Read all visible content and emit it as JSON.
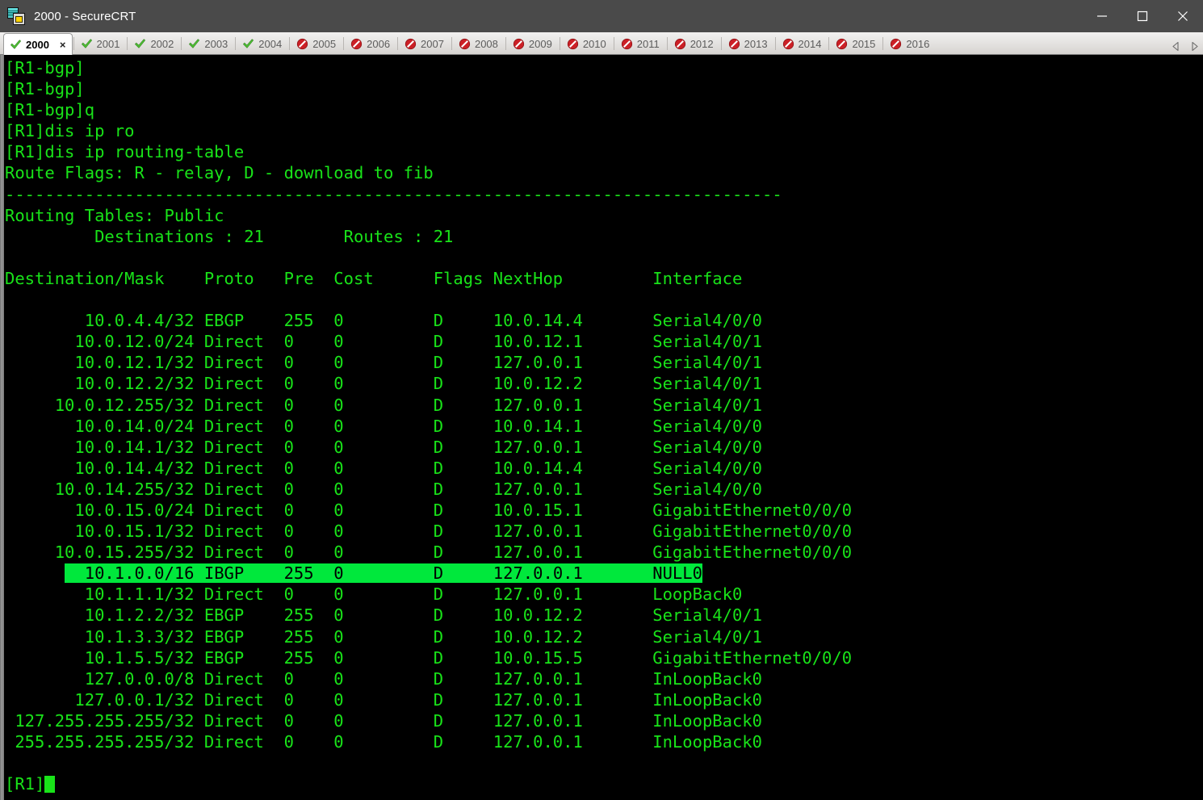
{
  "window": {
    "title": "2000 - SecureCRT",
    "icon": "securecrt-icon",
    "controls": {
      "minimize": "minimize-icon",
      "maximize": "maximize-icon",
      "close": "close-icon"
    }
  },
  "tabs": {
    "items": [
      {
        "label": "2000",
        "status": "connected",
        "active": true,
        "closable": true
      },
      {
        "label": "2001",
        "status": "connected",
        "active": false,
        "closable": false
      },
      {
        "label": "2002",
        "status": "connected",
        "active": false,
        "closable": false
      },
      {
        "label": "2003",
        "status": "connected",
        "active": false,
        "closable": false
      },
      {
        "label": "2004",
        "status": "connected",
        "active": false,
        "closable": false
      },
      {
        "label": "2005",
        "status": "disconnected",
        "active": false,
        "closable": false
      },
      {
        "label": "2006",
        "status": "disconnected",
        "active": false,
        "closable": false
      },
      {
        "label": "2007",
        "status": "disconnected",
        "active": false,
        "closable": false
      },
      {
        "label": "2008",
        "status": "disconnected",
        "active": false,
        "closable": false
      },
      {
        "label": "2009",
        "status": "disconnected",
        "active": false,
        "closable": false
      },
      {
        "label": "2010",
        "status": "disconnected",
        "active": false,
        "closable": false
      },
      {
        "label": "2011",
        "status": "disconnected",
        "active": false,
        "closable": false
      },
      {
        "label": "2012",
        "status": "disconnected",
        "active": false,
        "closable": false
      },
      {
        "label": "2013",
        "status": "disconnected",
        "active": false,
        "closable": false
      },
      {
        "label": "2014",
        "status": "disconnected",
        "active": false,
        "closable": false
      },
      {
        "label": "2015",
        "status": "disconnected",
        "active": false,
        "closable": false
      },
      {
        "label": "2016",
        "status": "disconnected",
        "active": false,
        "closable": false
      }
    ],
    "close_glyph": "×",
    "nav_prev": "scroll-tabs-left-icon",
    "nav_next": "scroll-tabs-right-icon"
  },
  "terminal": {
    "colors": {
      "background": "#000000",
      "foreground": "#19e319",
      "selection_background": "#00e83c",
      "selection_foreground": "#000000"
    },
    "scrollback": [
      "[R1-bgp]",
      "[R1-bgp]",
      "[R1-bgp]q",
      "[R1]dis ip ro",
      "[R1]dis ip routing-table",
      "Route Flags: R - relay, D - download to fib",
      "------------------------------------------------------------------------------",
      "Routing Tables: Public",
      "         Destinations : 21        Routes : 21",
      ""
    ],
    "table_header": "Destination/Mask    Proto   Pre  Cost      Flags NextHop         Interface",
    "blank_after_header": "",
    "rows": [
      {
        "destination": "10.0.4.4/32",
        "proto": "EBGP",
        "pre": "255",
        "cost": "0",
        "flags": "D",
        "nexthop": "10.0.14.4",
        "interface": "Serial4/0/0",
        "selected": false
      },
      {
        "destination": "10.0.12.0/24",
        "proto": "Direct",
        "pre": "0",
        "cost": "0",
        "flags": "D",
        "nexthop": "10.0.12.1",
        "interface": "Serial4/0/1",
        "selected": false
      },
      {
        "destination": "10.0.12.1/32",
        "proto": "Direct",
        "pre": "0",
        "cost": "0",
        "flags": "D",
        "nexthop": "127.0.0.1",
        "interface": "Serial4/0/1",
        "selected": false
      },
      {
        "destination": "10.0.12.2/32",
        "proto": "Direct",
        "pre": "0",
        "cost": "0",
        "flags": "D",
        "nexthop": "10.0.12.2",
        "interface": "Serial4/0/1",
        "selected": false
      },
      {
        "destination": "10.0.12.255/32",
        "proto": "Direct",
        "pre": "0",
        "cost": "0",
        "flags": "D",
        "nexthop": "127.0.0.1",
        "interface": "Serial4/0/1",
        "selected": false
      },
      {
        "destination": "10.0.14.0/24",
        "proto": "Direct",
        "pre": "0",
        "cost": "0",
        "flags": "D",
        "nexthop": "10.0.14.1",
        "interface": "Serial4/0/0",
        "selected": false
      },
      {
        "destination": "10.0.14.1/32",
        "proto": "Direct",
        "pre": "0",
        "cost": "0",
        "flags": "D",
        "nexthop": "127.0.0.1",
        "interface": "Serial4/0/0",
        "selected": false
      },
      {
        "destination": "10.0.14.4/32",
        "proto": "Direct",
        "pre": "0",
        "cost": "0",
        "flags": "D",
        "nexthop": "10.0.14.4",
        "interface": "Serial4/0/0",
        "selected": false
      },
      {
        "destination": "10.0.14.255/32",
        "proto": "Direct",
        "pre": "0",
        "cost": "0",
        "flags": "D",
        "nexthop": "127.0.0.1",
        "interface": "Serial4/0/0",
        "selected": false
      },
      {
        "destination": "10.0.15.0/24",
        "proto": "Direct",
        "pre": "0",
        "cost": "0",
        "flags": "D",
        "nexthop": "10.0.15.1",
        "interface": "GigabitEthernet0/0/0",
        "selected": false
      },
      {
        "destination": "10.0.15.1/32",
        "proto": "Direct",
        "pre": "0",
        "cost": "0",
        "flags": "D",
        "nexthop": "127.0.0.1",
        "interface": "GigabitEthernet0/0/0",
        "selected": false
      },
      {
        "destination": "10.0.15.255/32",
        "proto": "Direct",
        "pre": "0",
        "cost": "0",
        "flags": "D",
        "nexthop": "127.0.0.1",
        "interface": "GigabitEthernet0/0/0",
        "selected": false
      },
      {
        "destination": "10.1.0.0/16",
        "proto": "IBGP",
        "pre": "255",
        "cost": "0",
        "flags": "D",
        "nexthop": "127.0.0.1",
        "interface": "NULL0",
        "selected": true
      },
      {
        "destination": "10.1.1.1/32",
        "proto": "Direct",
        "pre": "0",
        "cost": "0",
        "flags": "D",
        "nexthop": "127.0.0.1",
        "interface": "LoopBack0",
        "selected": false
      },
      {
        "destination": "10.1.2.2/32",
        "proto": "EBGP",
        "pre": "255",
        "cost": "0",
        "flags": "D",
        "nexthop": "10.0.12.2",
        "interface": "Serial4/0/1",
        "selected": false
      },
      {
        "destination": "10.1.3.3/32",
        "proto": "EBGP",
        "pre": "255",
        "cost": "0",
        "flags": "D",
        "nexthop": "10.0.12.2",
        "interface": "Serial4/0/1",
        "selected": false
      },
      {
        "destination": "10.1.5.5/32",
        "proto": "EBGP",
        "pre": "255",
        "cost": "0",
        "flags": "D",
        "nexthop": "10.0.15.5",
        "interface": "GigabitEthernet0/0/0",
        "selected": false
      },
      {
        "destination": "127.0.0.0/8",
        "proto": "Direct",
        "pre": "0",
        "cost": "0",
        "flags": "D",
        "nexthop": "127.0.0.1",
        "interface": "InLoopBack0",
        "selected": false
      },
      {
        "destination": "127.0.0.1/32",
        "proto": "Direct",
        "pre": "0",
        "cost": "0",
        "flags": "D",
        "nexthop": "127.0.0.1",
        "interface": "InLoopBack0",
        "selected": false
      },
      {
        "destination": "127.255.255.255/32",
        "proto": "Direct",
        "pre": "0",
        "cost": "0",
        "flags": "D",
        "nexthop": "127.0.0.1",
        "interface": "InLoopBack0",
        "selected": false
      },
      {
        "destination": "255.255.255.255/32",
        "proto": "Direct",
        "pre": "0",
        "cost": "0",
        "flags": "D",
        "nexthop": "127.0.0.1",
        "interface": "InLoopBack0",
        "selected": false
      }
    ],
    "prompt": "[R1]",
    "cursor": "block-cursor"
  }
}
